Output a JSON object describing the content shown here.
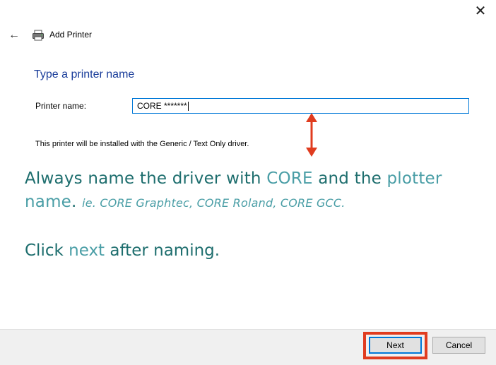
{
  "window": {
    "close_glyph": "✕",
    "back_glyph": "←",
    "title": "Add Printer",
    "icons": [
      "close-icon",
      "back-arrow-icon",
      "printer-icon"
    ]
  },
  "main": {
    "heading": "Type a printer name",
    "field_label": "Printer name:",
    "printer_name_value": "CORE *******",
    "driver_note": "This printer will be installed with the Generic / Text Only driver."
  },
  "annotation": {
    "line1_a": "Always name the driver with ",
    "line1_hl1": "CORE",
    "line1_b": " and the ",
    "line1_hl2": "plotter name",
    "line1_c": ". ",
    "line1_example": "ie. CORE Graphtec, CORE Roland, CORE GCC.",
    "line2_a": "Click ",
    "line2_hl": "next",
    "line2_b": " after naming.",
    "arrow_color": "#e03c1f",
    "highlight_color": "#e03c1f"
  },
  "footer": {
    "next_label": "Next",
    "cancel_label": "Cancel"
  }
}
